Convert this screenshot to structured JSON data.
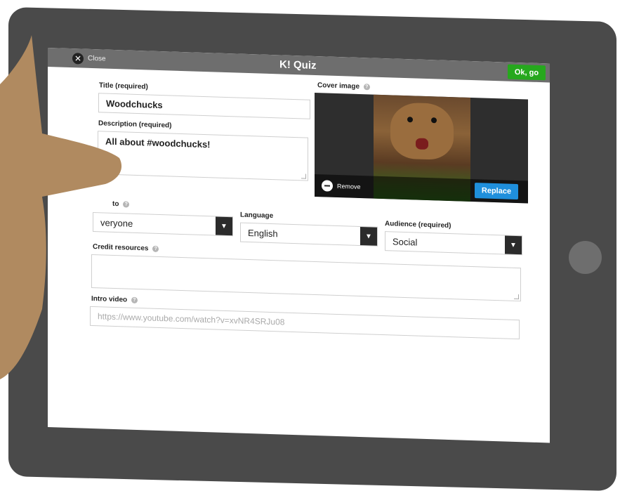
{
  "app": {
    "title": "K! Quiz",
    "close_label": "Close",
    "ok_label": "Ok, go"
  },
  "form": {
    "title": {
      "label": "Title (required)",
      "value": "Woodchucks"
    },
    "description": {
      "label": "Description (required)",
      "value": "All about #woodchucks!"
    },
    "cover_image": {
      "label": "Cover image",
      "remove_label": "Remove",
      "replace_label": "Replace"
    },
    "visible_to": {
      "label": "to",
      "value": "veryone"
    },
    "language": {
      "label": "Language",
      "value": "English"
    },
    "audience": {
      "label": "Audience (required)",
      "value": "Social"
    },
    "credit_resources": {
      "label": "Credit resources",
      "value": ""
    },
    "intro_video": {
      "label": "Intro video",
      "placeholder": "https://www.youtube.com/watch?v=xvNR4SRJu08"
    }
  },
  "colors": {
    "topbar": "#6e6e6e",
    "ok_button": "#26a81d",
    "replace_button": "#1f8fdc",
    "tablet_frame": "#4a4a4a",
    "hand": "#b08a60"
  },
  "icons": [
    "close-icon",
    "info-icon",
    "dropdown-arrow-icon",
    "remove-icon"
  ]
}
